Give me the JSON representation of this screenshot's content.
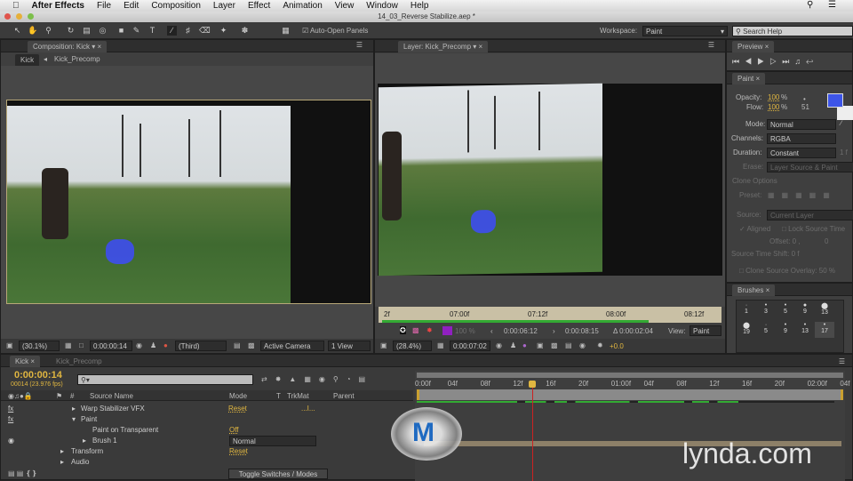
{
  "menubar": {
    "app": "After Effects",
    "items": [
      "File",
      "Edit",
      "Composition",
      "Layer",
      "Effect",
      "Animation",
      "View",
      "Window",
      "Help"
    ]
  },
  "window_title": "14_03_Reverse Stabilize.aep *",
  "toolbar": {
    "auto_open_panels": "Auto-Open Panels",
    "auto_open_checked": true,
    "workspace_label": "Workspace:",
    "workspace_value": "Paint",
    "search_placeholder": "Search Help"
  },
  "comp_panel": {
    "tab": "Composition: Kick",
    "breadcrumb": [
      "Kick",
      "Kick_Precomp"
    ],
    "zoom": "(30.1%)",
    "timecode": "0:00:00:14",
    "resolution": "(Third)",
    "camera": "Active Camera",
    "views": "1 View"
  },
  "layer_panel": {
    "tab": "Layer: Kick_Precomp",
    "ruler": [
      "2f",
      "07:00f",
      "07:12f",
      "08:00f",
      "08:12f"
    ],
    "opacity": "100 %",
    "in_point": "0:00:06:12",
    "out_point": "0:00:08:15",
    "duration": "Δ 0:00:02:04",
    "view_label": "View:",
    "view_value": "Paint",
    "zoom": "(28.4%)",
    "timecode": "0:00:07:02",
    "exposure": "+0.0"
  },
  "preview": {
    "tab": "Preview"
  },
  "paint": {
    "tab": "Paint",
    "opacity_label": "Opacity:",
    "opacity": "100",
    "flow_label": "Flow:",
    "flow": "100",
    "pct": "%",
    "brush_size": "51",
    "foreground_color": "#3d55e8",
    "background_color": "#eeeeee",
    "mode_label": "Mode:",
    "mode": "Normal",
    "channels_label": "Channels:",
    "channels": "RGBA",
    "duration_label": "Duration:",
    "duration": "Constant",
    "duration_frames": "1 f",
    "erase_label": "Erase:",
    "erase": "Layer Source & Paint",
    "clone_options": "Clone Options",
    "preset_label": "Preset:",
    "source_label": "Source:",
    "source": "Current Layer",
    "aligned": "Aligned",
    "lock_source_time": "Lock Source Time",
    "offset": "Offset: 0 ,",
    "offset_y": "0",
    "source_time_shift": "Source Time Shift: 0 f",
    "clone_overlay": "Clone Source Overlay: 50 %"
  },
  "brushes": {
    "tab": "Brushes",
    "sizes": [
      "1",
      "3",
      "5",
      "9",
      "13",
      "19",
      "5",
      "9",
      "13",
      "17"
    ]
  },
  "timeline": {
    "tabs": [
      "Kick",
      "Kick_Precomp"
    ],
    "timecode": "0:00:00:14",
    "frames": "00014 (23.976 fps)",
    "columns": {
      "source": "Source Name",
      "mode": "Mode",
      "t": "T",
      "trkmat": "TrkMat",
      "parent": "Parent",
      "num": "#"
    },
    "rows": [
      {
        "name": "Warp Stabilizer VFX",
        "value": "Reset",
        "fx": true,
        "extra": "...I..."
      },
      {
        "name": "Paint",
        "value": "",
        "fx": true
      },
      {
        "name": "Paint on Transparent",
        "value": "Off"
      },
      {
        "name": "Brush 1",
        "value": "Normal",
        "eye": true
      },
      {
        "name": "Transform",
        "value": "Reset"
      },
      {
        "name": "Audio",
        "value": ""
      }
    ],
    "toggle": "Toggle Switches / Modes",
    "ruler": [
      "0:00f",
      "04f",
      "08f",
      "12f",
      "16f",
      "20f",
      "01:00f",
      "04f",
      "08f",
      "12f",
      "16f",
      "20f",
      "02:00f",
      "04f"
    ]
  },
  "watermark": "lynda.com"
}
